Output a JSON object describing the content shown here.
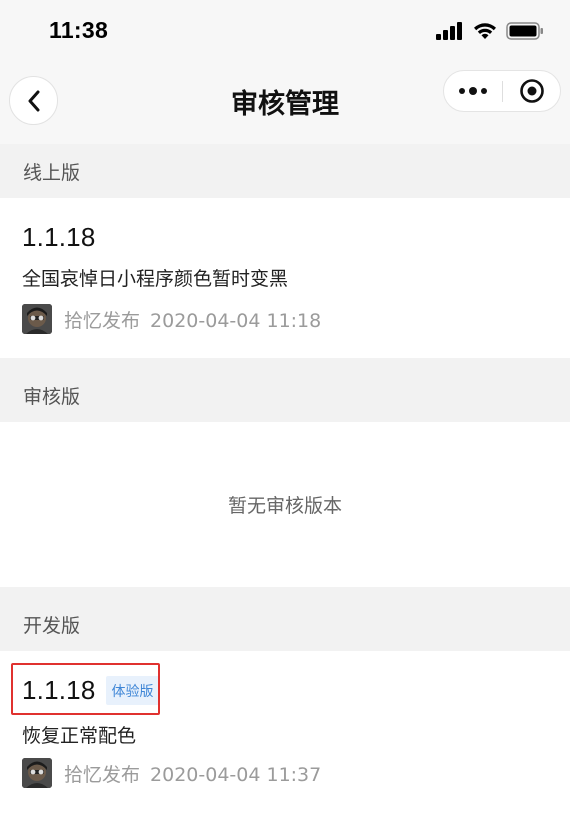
{
  "status_bar": {
    "time": "11:38"
  },
  "nav": {
    "title": "审核管理"
  },
  "sections": {
    "online": {
      "header": "线上版",
      "version": "1.1.18",
      "description": "全国哀悼日小程序颜色暂时变黑",
      "publisher": "拾忆发布",
      "timestamp": "2020-04-04 11:18"
    },
    "review": {
      "header": "审核版",
      "empty_text": "暂无审核版本"
    },
    "dev": {
      "header": "开发版",
      "version": "1.1.18",
      "badge": "体验版",
      "description": "恢复正常配色",
      "publisher": "拾忆发布",
      "timestamp": "2020-04-04 11:37"
    }
  },
  "colors": {
    "badge_bg": "#e8f1fc",
    "badge_text": "#3f86d6",
    "highlight": "#e0312f"
  }
}
